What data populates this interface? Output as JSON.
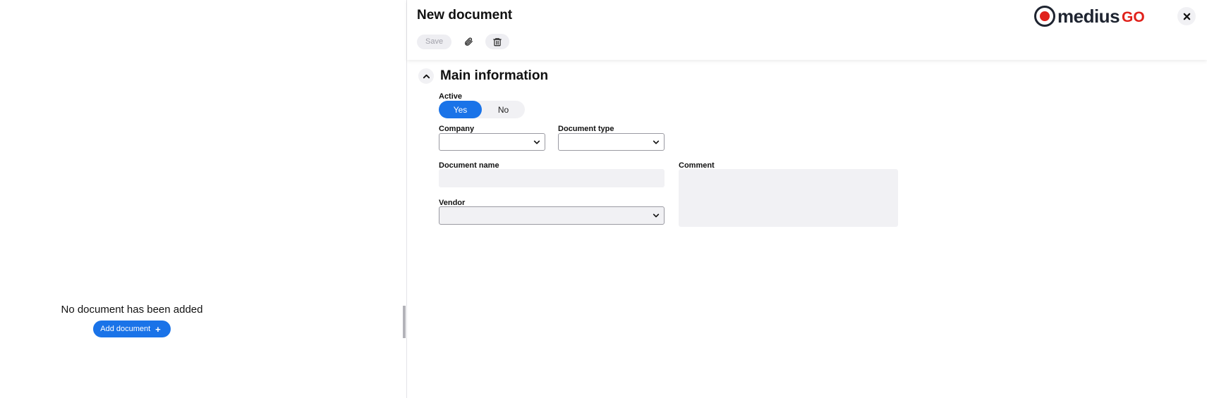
{
  "left_panel": {
    "empty_message": "No document has been added",
    "add_button_label": "Add document",
    "add_button_icon": "plus-icon"
  },
  "header": {
    "title": "New document",
    "save_label": "Save",
    "attach_icon": "paperclip-icon",
    "delete_icon": "trash-icon",
    "close_icon": "close-icon",
    "logo": {
      "medius": "medius",
      "go": "GO",
      "brand_color": "#e0211b"
    }
  },
  "section": {
    "title": "Main information",
    "collapse_icon": "chevron-up-icon"
  },
  "form": {
    "active": {
      "label": "Active",
      "options": [
        "Yes",
        "No"
      ],
      "selected": "Yes"
    },
    "company": {
      "label": "Company",
      "value": ""
    },
    "document_type": {
      "label": "Document type",
      "value": ""
    },
    "document_name": {
      "label": "Document name",
      "value": ""
    },
    "comment": {
      "label": "Comment",
      "value": ""
    },
    "vendor": {
      "label": "Vendor",
      "value": ""
    }
  },
  "colors": {
    "accent": "#1a73e8",
    "field_bg": "#f1f1f4"
  }
}
